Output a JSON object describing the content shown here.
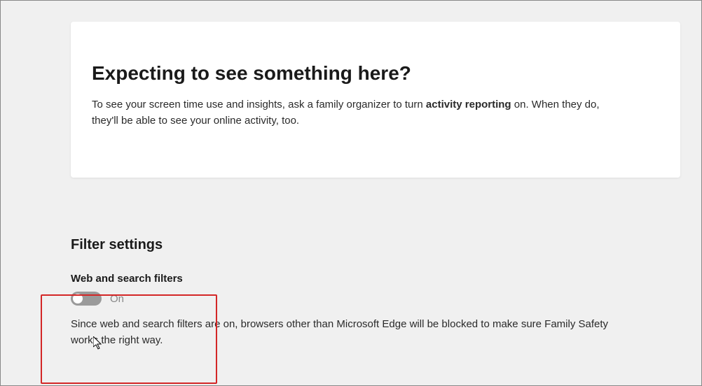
{
  "card": {
    "title": "Expecting to see something here?",
    "desc_before": "To see your screen time use and insights, ask a family organizer to turn ",
    "desc_bold": "activity reporting",
    "desc_after": " on. When they do, they'll be able to see your online activity, too."
  },
  "section": {
    "heading": "Filter settings",
    "filter_title": "Web and search filters",
    "toggle_state": "On",
    "filter_desc": "Since web and search filters are on, browsers other than Microsoft Edge will be blocked to make sure Family Safety works the right way."
  }
}
